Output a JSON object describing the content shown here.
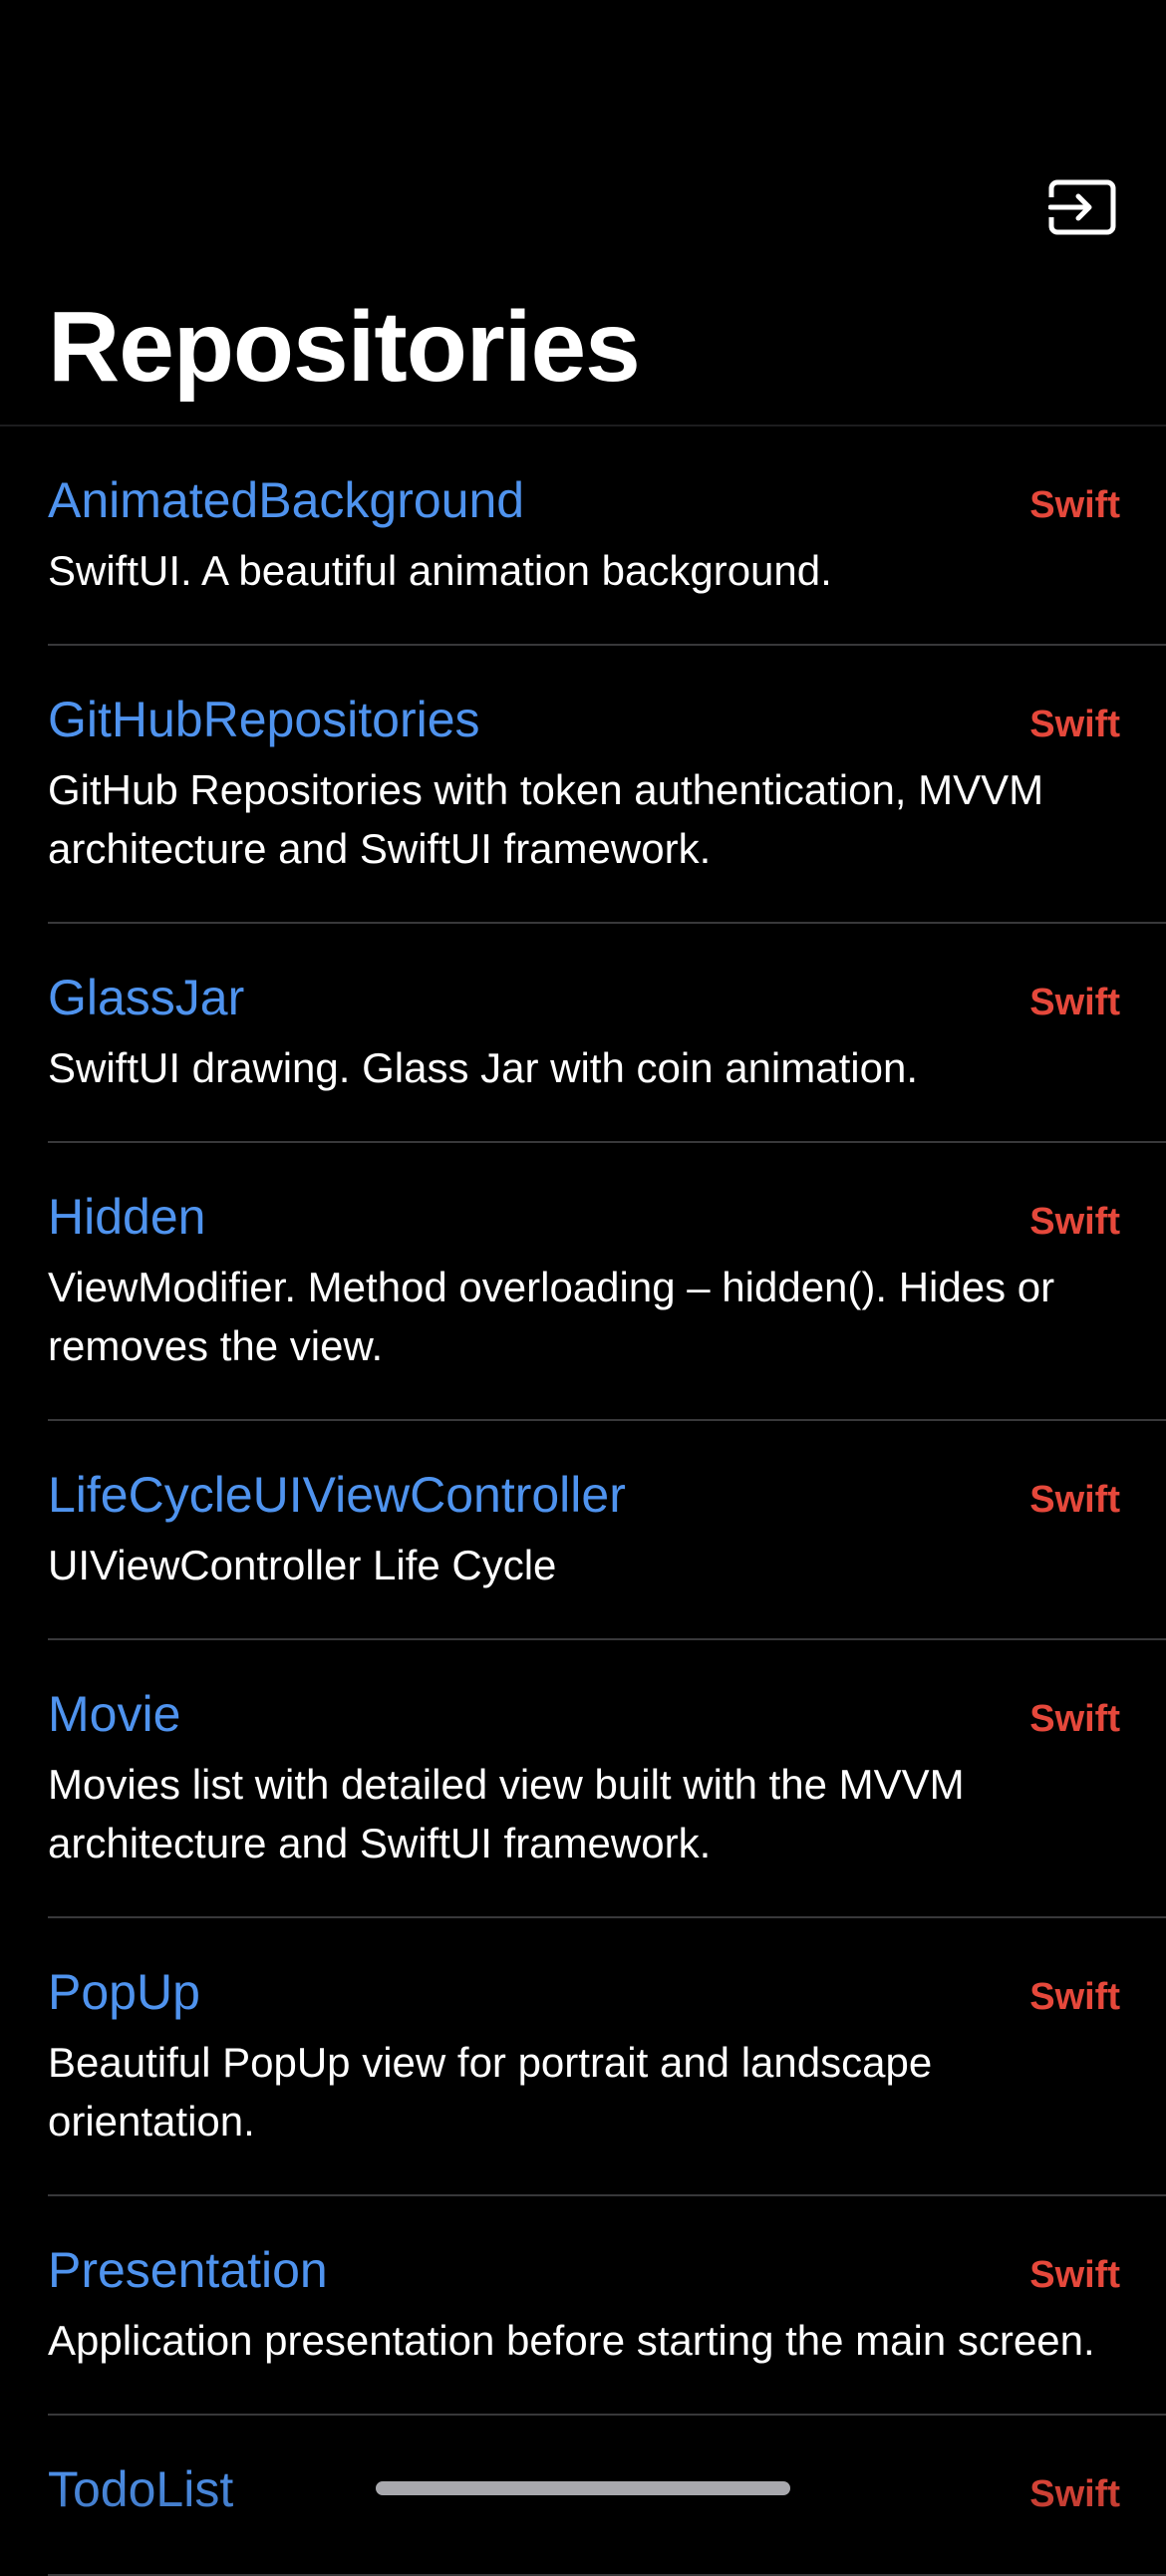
{
  "header": {
    "title": "Repositories",
    "logout_icon": "logout-icon"
  },
  "repositories": [
    {
      "name": "AnimatedBackground",
      "language": "Swift",
      "description": "SwiftUI. A beautiful animation background."
    },
    {
      "name": "GitHubRepositories",
      "language": "Swift",
      "description": "GitHub Repositories with token authentication, MVVM architecture and SwiftUI framework."
    },
    {
      "name": "GlassJar",
      "language": "Swift",
      "description": "SwiftUI drawing. Glass Jar with coin animation."
    },
    {
      "name": "Hidden",
      "language": "Swift",
      "description": "ViewModifier. Method overloading – hidden(). Hides or removes the view."
    },
    {
      "name": "LifeCycleUIViewController",
      "language": "Swift",
      "description": "UIViewController Life Cycle"
    },
    {
      "name": "Movie",
      "language": "Swift",
      "description": "Movies list with detailed view built with the MVVM architecture and SwiftUI framework."
    },
    {
      "name": "PopUp",
      "language": "Swift",
      "description": "Beautiful PopUp view for portrait and landscape orientation."
    },
    {
      "name": "Presentation",
      "language": "Swift",
      "description": "Application presentation before starting the main screen."
    },
    {
      "name": "TodoList",
      "language": "Swift",
      "description": ""
    }
  ],
  "colors": {
    "background": "#000000",
    "repo_name": "#4f93ee",
    "language": "#e5483b",
    "divider": "#38383a"
  }
}
